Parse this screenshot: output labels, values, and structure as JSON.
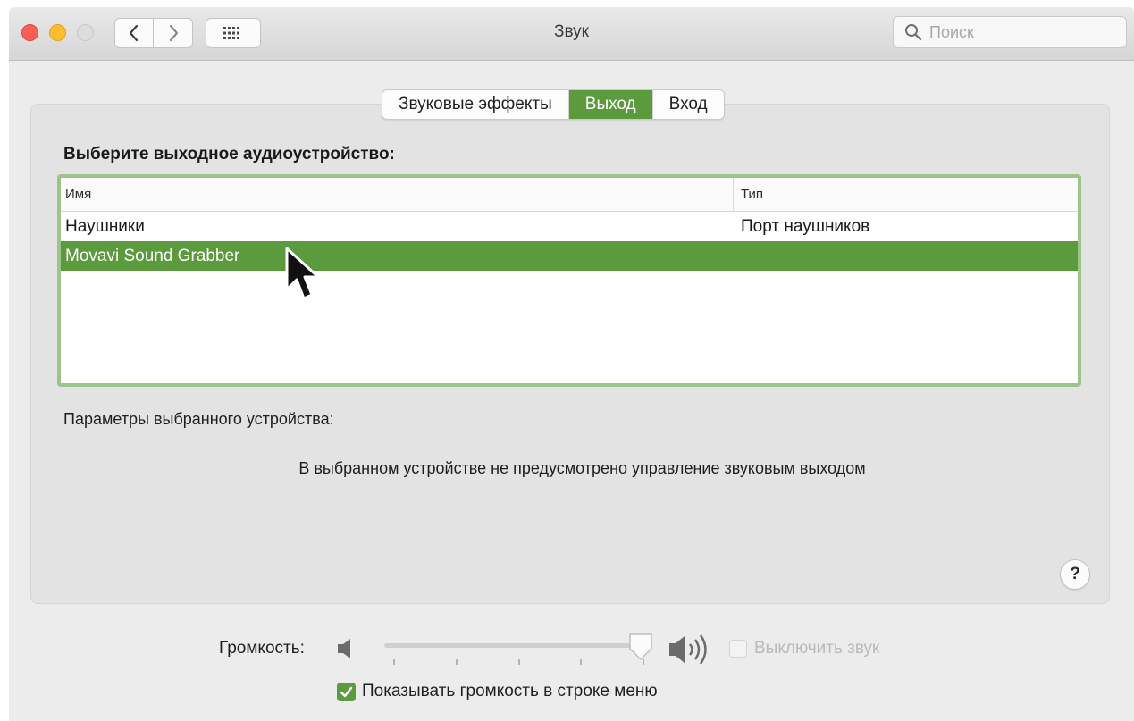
{
  "window": {
    "title": "Звук",
    "search_placeholder": "Поиск"
  },
  "tabs": [
    {
      "label": "Звуковые эффекты",
      "active": false
    },
    {
      "label": "Выход",
      "active": true
    },
    {
      "label": "Вход",
      "active": false
    }
  ],
  "output": {
    "heading": "Выберите выходное аудиоустройство:",
    "columns": {
      "name": "Имя",
      "type": "Тип"
    },
    "devices": [
      {
        "name": "Наушники",
        "type": "Порт наушников",
        "selected": false
      },
      {
        "name": "Movavi Sound Grabber",
        "type": "",
        "selected": true
      }
    ],
    "params_label": "Параметры выбранного устройства:",
    "no_control_message": "В выбранном устройстве не предусмотрено управление звуковым выходом"
  },
  "help_label": "?",
  "volume": {
    "label": "Громкость:",
    "level": 0.9,
    "mute_label": "Выключить звук",
    "mute_checked": false,
    "show_in_menu_label": "Показывать громкость в строке меню",
    "show_in_menu_checked": true
  },
  "colors": {
    "accent": "#5b9a3d",
    "focus_ring": "#9cc48b"
  },
  "icons": [
    "chevron-left-icon",
    "chevron-right-icon",
    "grid-icon",
    "search-icon",
    "speaker-low-icon",
    "speaker-high-icon",
    "checkmark-icon",
    "mouse-pointer-icon"
  ]
}
